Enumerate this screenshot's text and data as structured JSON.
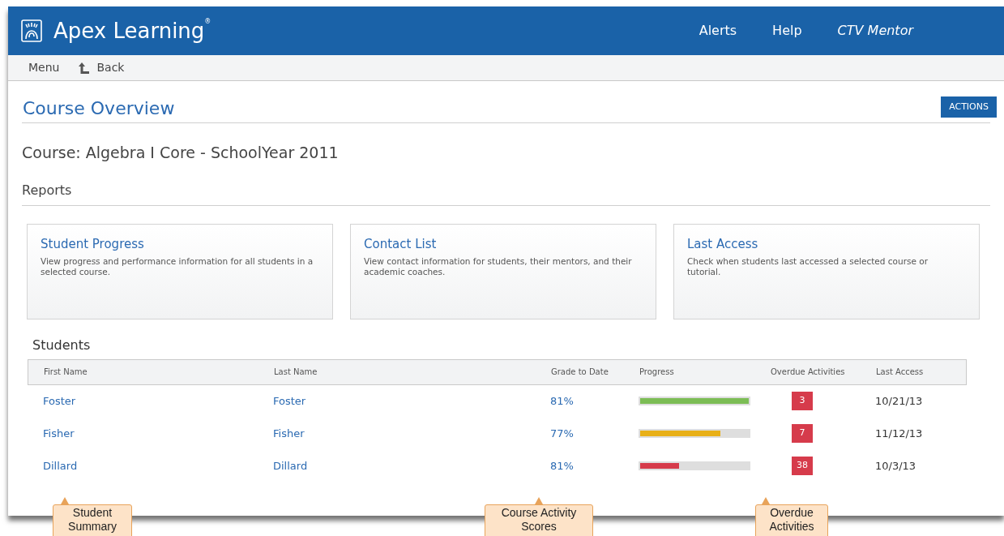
{
  "header": {
    "brand": "Apex Learning",
    "brand_mark": "®",
    "links": [
      "Alerts",
      "Help"
    ],
    "user": "CTV Mentor"
  },
  "subnav": {
    "menu": "Menu",
    "back": "Back"
  },
  "page": {
    "title": "Course Overview",
    "actions": "ACTIONS",
    "course": "Course: Algebra I Core - SchoolYear 2011",
    "section": "Reports"
  },
  "reports": [
    {
      "title": "Student Progress",
      "description": "View progress and performance information for all students in a selected course."
    },
    {
      "title": "Contact List",
      "description": "View contact information for students, their mentors, and their academic coaches."
    },
    {
      "title": "Last Access",
      "description": "Check when students last accessed a selected course or tutorial."
    }
  ],
  "students": {
    "title": "Students",
    "columns": [
      "First Name",
      "Last Name",
      "Grade to Date",
      "Progress",
      "Overdue Activities",
      "Last Access"
    ],
    "rows": [
      {
        "first": "Foster",
        "last": "Foster",
        "grade": "81%",
        "progress": {
          "level": 1.0,
          "color": "#7cbd55"
        },
        "overdue": "3",
        "last_access": "10/21/13"
      },
      {
        "first": "Fisher",
        "last": "Fisher",
        "grade": "77%",
        "progress": {
          "level": 0.74,
          "color": "#e8b018"
        },
        "overdue": "7",
        "last_access": "11/12/13"
      },
      {
        "first": "Dillard",
        "last": "Dillard",
        "grade": "81%",
        "progress": {
          "level": 0.36,
          "color": "#d63b4b"
        },
        "overdue": "38",
        "last_access": "10/3/13"
      }
    ]
  },
  "callouts": [
    "Student Summary",
    "Course Activity Scores",
    "Overdue Activities"
  ]
}
